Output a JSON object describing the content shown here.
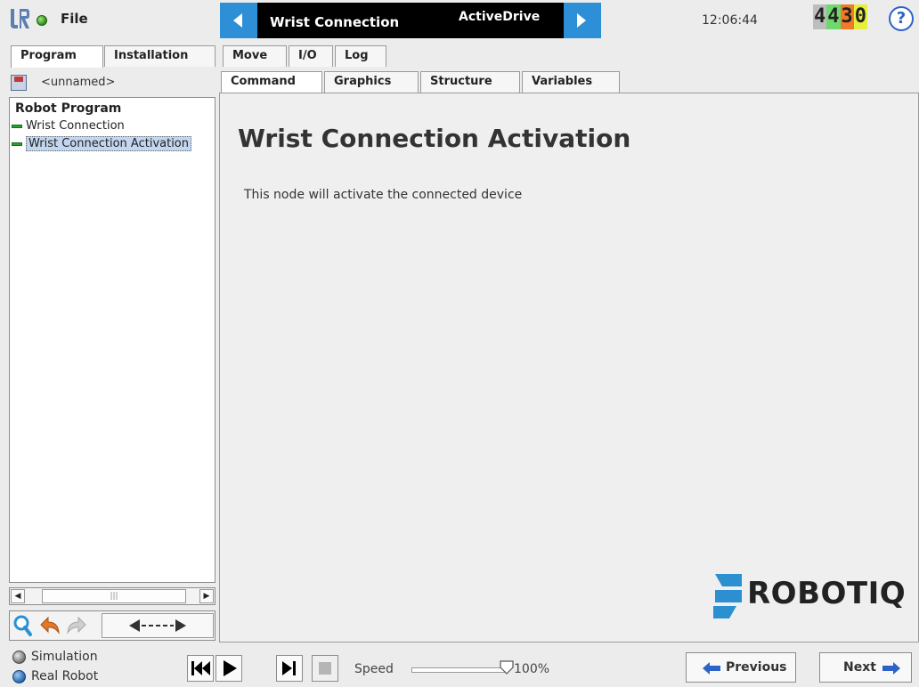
{
  "topbar": {
    "file_label": "File",
    "program_name": "Wrist Connection",
    "node_type": "ActiveDrive",
    "clock": "12:06:44",
    "counter_digits": [
      "4",
      "4",
      "3",
      "0"
    ],
    "counter_colors": [
      "#bdbdbd",
      "#6fd86f",
      "#f07a2a",
      "#e6ef3a"
    ],
    "help_label": "?"
  },
  "main_tabs": [
    "Program",
    "Installation",
    "Move",
    "I/O",
    "Log"
  ],
  "left_panel": {
    "file_name": "<unnamed>",
    "tree_title": "Robot Program",
    "tree_items": [
      "Wrist Connection",
      "Wrist Connection Activation"
    ]
  },
  "sub_tabs": [
    "Command",
    "Graphics",
    "Structure",
    "Variables"
  ],
  "content": {
    "title": "Wrist Connection Activation",
    "description": "This node will activate the connected device",
    "logo_text": "ROBOTIQ"
  },
  "bottombar": {
    "mode_simulation": "Simulation",
    "mode_real": "Real Robot",
    "speed_label": "Speed",
    "speed_value": "100%",
    "speed_fraction": 1.0,
    "previous_label": "Previous",
    "next_label": "Next"
  },
  "colors": {
    "accent_blue": "#2d8fd5",
    "robotiq_blue": "#2b8fd0"
  }
}
